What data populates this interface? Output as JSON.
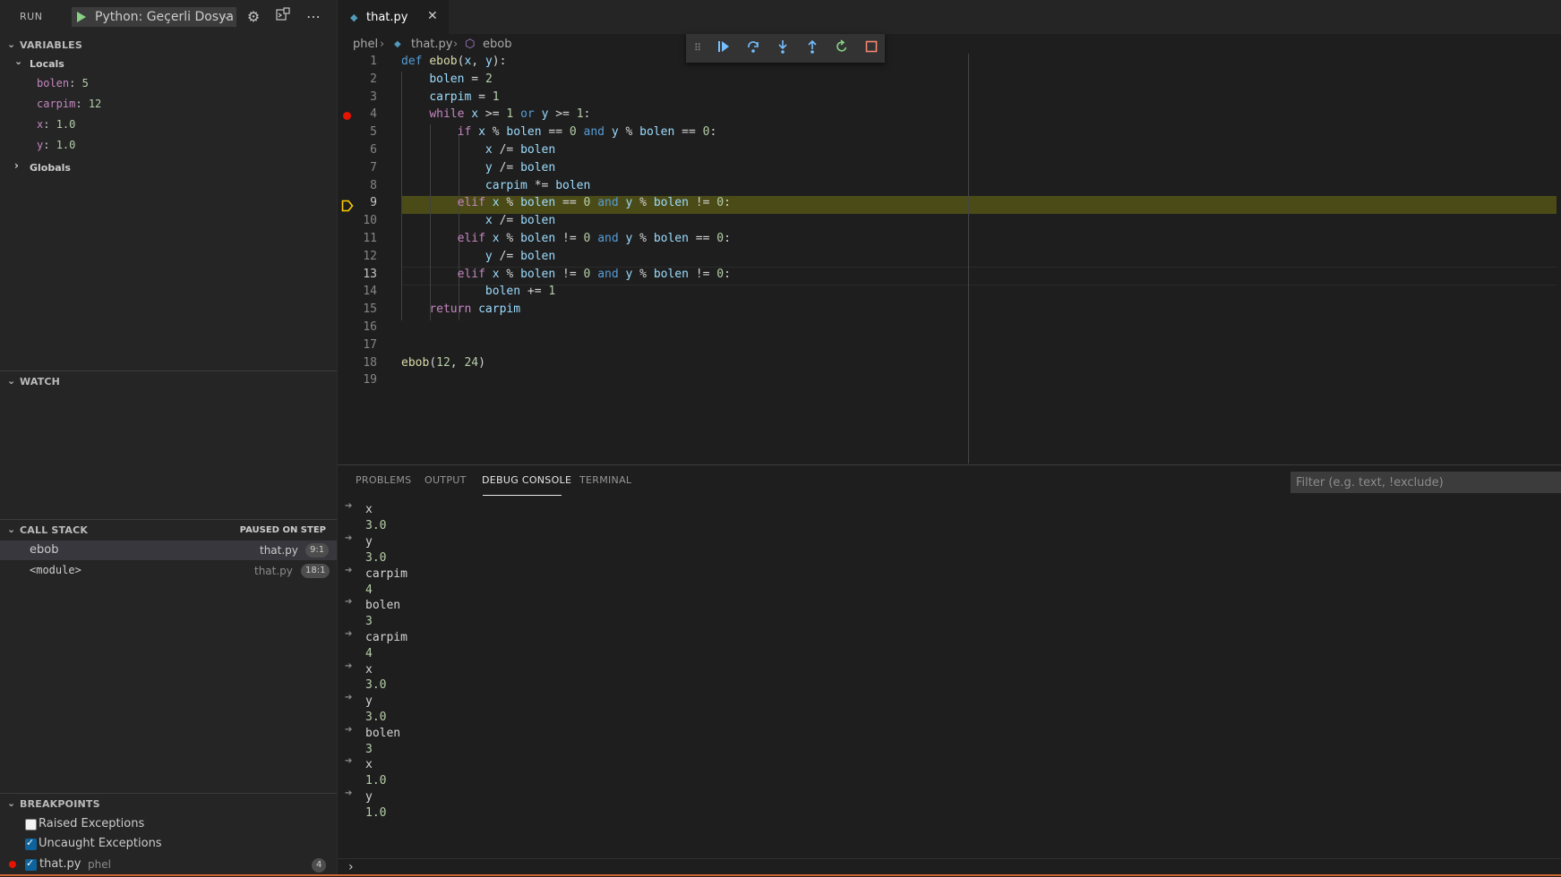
{
  "run": {
    "title": "RUN",
    "config_label": "Python: Geçerli Dosya",
    "icons": [
      "play-icon",
      "gear-icon",
      "debug-console-icon",
      "more-icon"
    ]
  },
  "variables": {
    "header": "VARIABLES",
    "locals_label": "Locals",
    "locals": [
      {
        "name": "bolen",
        "value": "5"
      },
      {
        "name": "carpim",
        "value": "12"
      },
      {
        "name": "x",
        "value": "1.0"
      },
      {
        "name": "y",
        "value": "1.0"
      }
    ],
    "globals_label": "Globals"
  },
  "watch": {
    "header": "WATCH"
  },
  "callstack": {
    "header": "CALL STACK",
    "status": "PAUSED ON STEP",
    "frames": [
      {
        "name": "ebob",
        "file": "that.py",
        "pos": "9:1"
      },
      {
        "name": "<module>",
        "file": "that.py",
        "pos": "18:1"
      }
    ]
  },
  "breakpoints": {
    "header": "BREAKPOINTS",
    "items": [
      {
        "label": "Raised Exceptions",
        "checked": false
      },
      {
        "label": "Uncaught Exceptions",
        "checked": true
      },
      {
        "label": "that.py",
        "folder": "phel",
        "count": "4",
        "checked": true
      }
    ]
  },
  "editor": {
    "tab_label": "that.py",
    "breadcrumb": {
      "folder": "phel",
      "file": "that.py",
      "symbol": "ebob"
    },
    "current_line": 9,
    "breakpoint_line": 4,
    "line_numbers": [
      "1",
      "2",
      "3",
      "4",
      "5",
      "6",
      "7",
      "8",
      "9",
      "10",
      "11",
      "12",
      "13",
      "14",
      "15",
      "16",
      "17",
      "18",
      "19"
    ]
  },
  "panel": {
    "tabs": [
      "PROBLEMS",
      "OUTPUT",
      "DEBUG CONSOLE",
      "TERMINAL"
    ],
    "active_tab": "DEBUG CONSOLE",
    "filter_placeholder": "Filter (e.g. text, !exclude)",
    "console": [
      {
        "in": "x",
        "out": "3.0"
      },
      {
        "in": "y",
        "out": "3.0"
      },
      {
        "in": "carpim",
        "out": "4"
      },
      {
        "in": "bolen",
        "out": "3"
      },
      {
        "in": "carpim",
        "out": "4"
      },
      {
        "in": "x",
        "out": "3.0"
      },
      {
        "in": "y",
        "out": "3.0"
      },
      {
        "in": "bolen",
        "out": "3"
      },
      {
        "in": "x",
        "out": "1.0"
      },
      {
        "in": "y",
        "out": "1.0"
      }
    ]
  },
  "colors": {
    "accent": "#0e639c",
    "breakpoint": "#e51400",
    "current_line_bg": "#4b4b18",
    "status_bar": "#cc6633"
  }
}
